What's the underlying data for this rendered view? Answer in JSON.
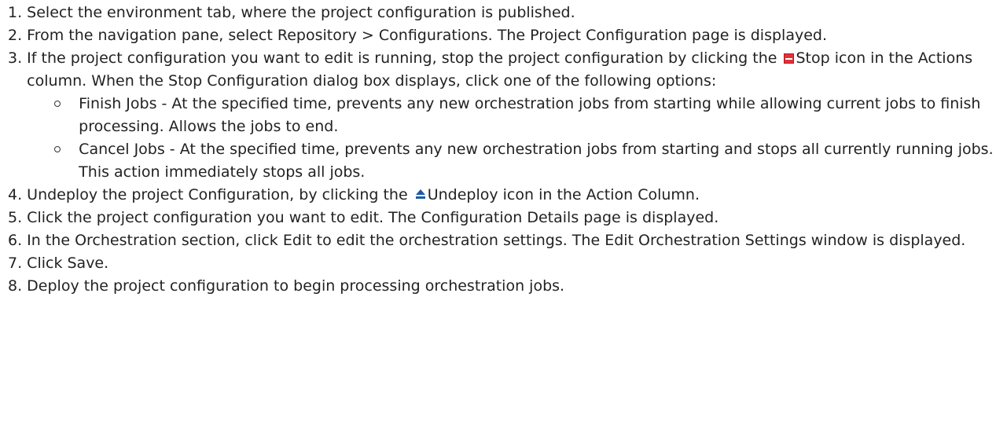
{
  "steps": [
    {
      "num": "1. ",
      "text": "Select the environment tab, where the project configuration is published."
    },
    {
      "num": "2. ",
      "text": "From the navigation pane, select Repository > Configurations. The Project Configuration page is displayed."
    },
    {
      "num": "3. ",
      "text_before": "If the project configuration you want to edit is running, stop the project configuration by clicking the",
      "icon": "stop-icon",
      "text_after": "Stop icon in the Actions column. When the Stop Configuration dialog box displays, click one of the following options:",
      "options": [
        "Finish Jobs - At the specified time, prevents any new orchestration jobs from starting while allowing current jobs to finish processing. Allows the jobs to end.",
        "Cancel Jobs - At the specified time, prevents any new orchestration jobs from starting and stops all currently running jobs. This action immediately stops all jobs."
      ]
    },
    {
      "num": "4. ",
      "text_before": "Undeploy the project Configuration, by clicking the",
      "icon": "undeploy-icon",
      "text_after": "Undeploy icon in the Action Column."
    },
    {
      "num": "5. ",
      "text": "Click the project configuration you want to edit. The Configuration Details page is displayed."
    },
    {
      "num": "6. ",
      "text": "In the Orchestration section, click Edit to edit the orchestration settings. The Edit Orchestration Settings window is displayed."
    },
    {
      "num": "7. ",
      "text": "Click Save."
    },
    {
      "num": "8. ",
      "text": "Deploy the project configuration to begin processing orchestration jobs."
    }
  ]
}
